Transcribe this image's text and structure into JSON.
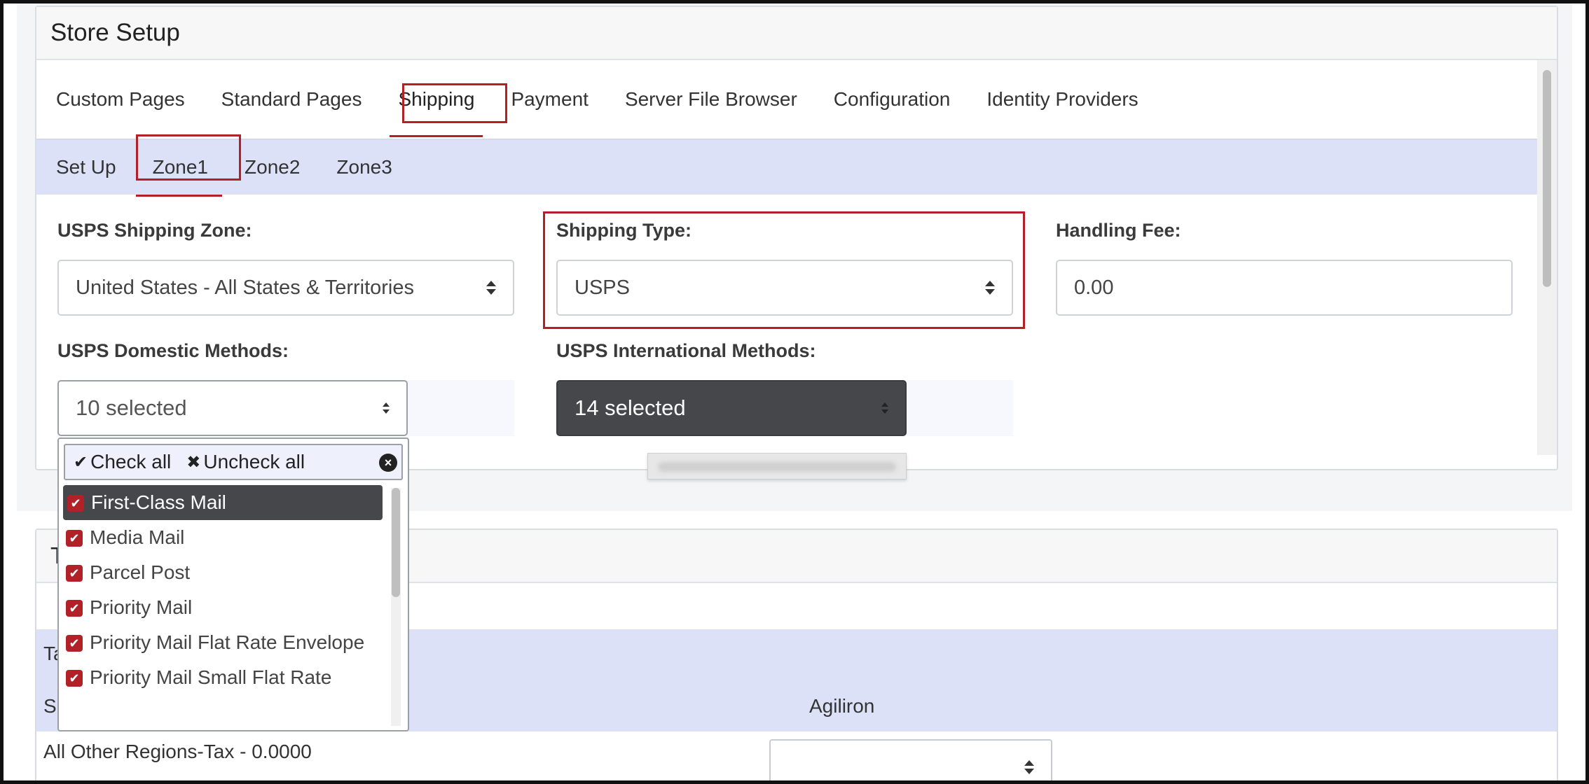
{
  "card": {
    "title": "Store Setup"
  },
  "tabs": [
    {
      "label": "Custom Pages"
    },
    {
      "label": "Standard Pages"
    },
    {
      "label": "Shipping"
    },
    {
      "label": "Payment"
    },
    {
      "label": "Server File Browser"
    },
    {
      "label": "Configuration"
    },
    {
      "label": "Identity Providers"
    }
  ],
  "subtabs": [
    {
      "label": "Set Up"
    },
    {
      "label": "Zone1"
    },
    {
      "label": "Zone2"
    },
    {
      "label": "Zone3"
    }
  ],
  "form": {
    "zone_label": "USPS Shipping Zone:",
    "zone_value": "United States - All States & Territories",
    "type_label": "Shipping Type:",
    "type_value": "USPS",
    "fee_label": "Handling Fee:",
    "fee_value": "0.00",
    "domestic_label": "USPS Domestic Methods:",
    "domestic_value": "10 selected",
    "international_label": "USPS International Methods:",
    "international_value": "14 selected"
  },
  "dropdown": {
    "check_all": "Check all",
    "uncheck_all": "Uncheck all",
    "items": [
      {
        "label": "First-Class Mail",
        "checked": true
      },
      {
        "label": "Media Mail",
        "checked": true
      },
      {
        "label": "Parcel Post",
        "checked": true
      },
      {
        "label": "Priority Mail",
        "checked": true
      },
      {
        "label": "Priority Mail Flat Rate Envelope",
        "checked": true
      },
      {
        "label": "Priority Mail Small Flat Rate",
        "checked": true
      }
    ]
  },
  "tax": {
    "header": "T",
    "band1_text": "Ta",
    "col1_text": "S",
    "col2_header": "Agiliron",
    "row_text": "All Other Regions-Tax - 0.0000"
  },
  "colors": {
    "accent": "#b22028",
    "band": "#dde1f7",
    "dark_button": "#45474b"
  }
}
